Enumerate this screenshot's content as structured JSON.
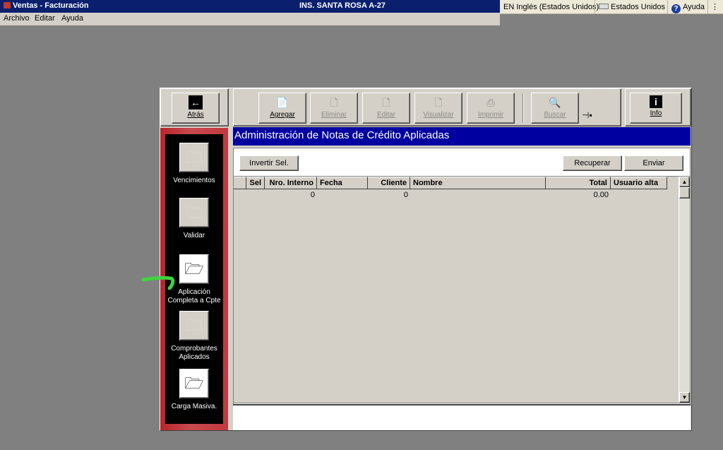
{
  "window": {
    "title": "Ventas - Facturación",
    "center_title": "INS. SANTA ROSA A-27"
  },
  "system": {
    "language": "EN Inglés (Estados Unidos)",
    "keyboard": "Estados Unidos",
    "help": "Ayuda"
  },
  "menu": [
    "Archivo",
    "Editar",
    "Ayuda"
  ],
  "toolbar": {
    "back": "Atrás",
    "add": "Agregar",
    "delete": "Eliminar",
    "edit": "Editar",
    "view": "Visualizar",
    "print": "Imprimir",
    "search": "Buscar",
    "info": "Info"
  },
  "sidebar": [
    {
      "label": "Vencimientos",
      "active": false
    },
    {
      "label": "Validar",
      "active": false
    },
    {
      "label": "Aplicación Completa a Cpte",
      "active": true
    },
    {
      "label": "Comprobantes Aplicados",
      "active": false
    },
    {
      "label": "Carga Masiva.",
      "active": true
    }
  ],
  "main": {
    "heading": "Administración de Notas de Crédito Aplicadas",
    "invert_button": "Invertir Sel.",
    "recover_button": "Recuperar",
    "send_button": "Enviar"
  },
  "grid": {
    "columns": [
      "Sel",
      "Nro. Interno",
      "Fecha",
      "Cliente",
      "Nombre",
      "Total",
      "Usuario alta"
    ],
    "rows": [
      {
        "nro_interno": "0",
        "cliente": "0",
        "total": "0.00"
      }
    ]
  },
  "colors": {
    "titlebar": "#0a1f6e",
    "header_band": "#0000a0",
    "sidebar_red": "#b8252b",
    "annotation_green": "#3fd43f"
  }
}
